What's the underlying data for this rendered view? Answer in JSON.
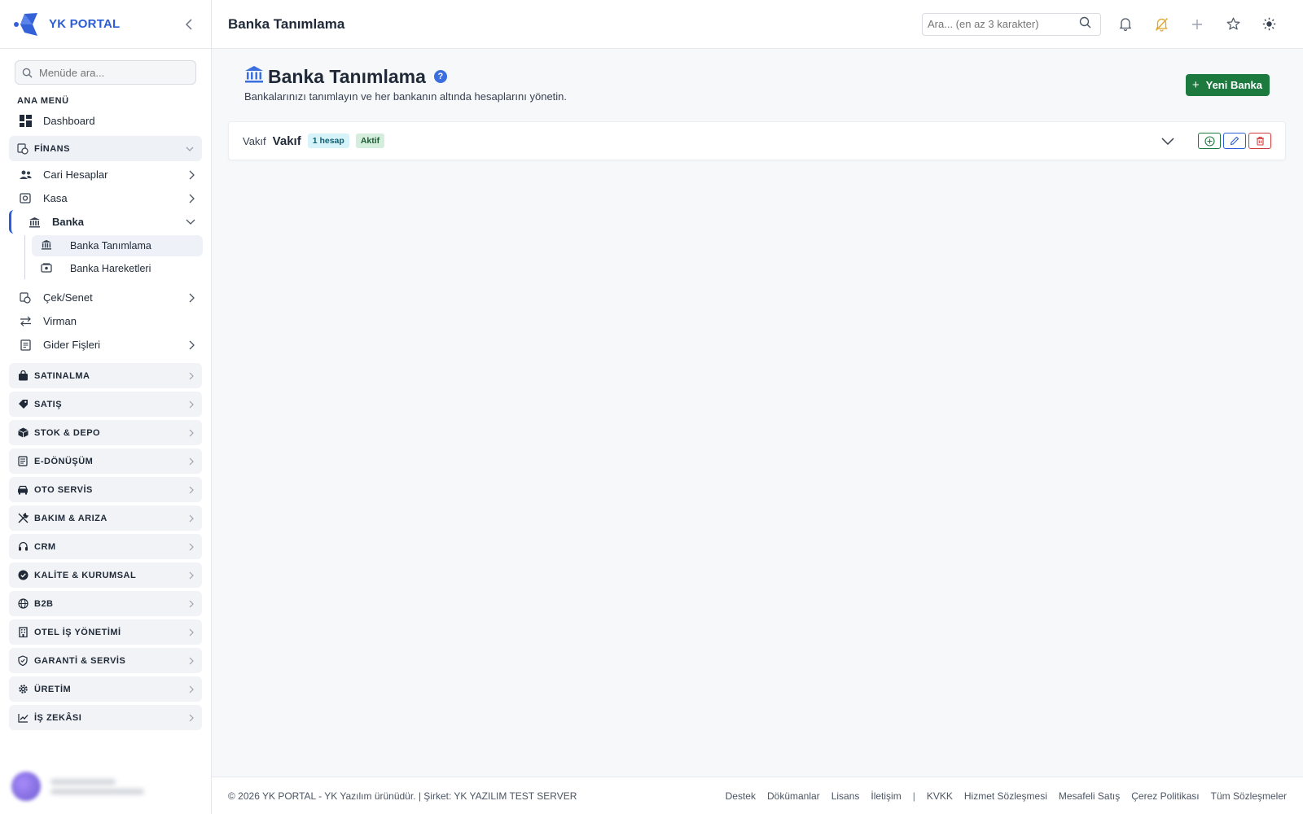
{
  "brand": {
    "name": "YK PORTAL"
  },
  "sidebar": {
    "search_placeholder": "Menüde ara...",
    "section_label": "ANA MENÜ",
    "dashboard": "Dashboard",
    "finance_group": "FİNANS",
    "finance_items": {
      "cari": "Cari Hesaplar",
      "kasa": "Kasa",
      "banka": "Banka",
      "banka_tanimlama": "Banka Tanımlama",
      "banka_hareketleri": "Banka Hareketleri",
      "cek_senet": "Çek/Senet",
      "virman": "Virman",
      "gider": "Gider Fişleri"
    },
    "groups": [
      "SATINALMA",
      "SATIŞ",
      "STOK & DEPO",
      "E-DÖNÜŞÜM",
      "OTO SERVİS",
      "BAKIM & ARIZA",
      "CRM",
      "KALİTE & KURUMSAL",
      "B2B",
      "OTEL İŞ YÖNETİMİ",
      "GARANTİ & SERVİS",
      "ÜRETİM",
      "İŞ ZEKÂSI"
    ]
  },
  "topbar": {
    "title": "Banka Tanımlama",
    "search_placeholder": "Ara... (en az 3 karakter)"
  },
  "page": {
    "title": "Banka Tanımlama",
    "help": "?",
    "subtitle": "Bankalarınızı tanımlayın ve her bankanın altında hesaplarını yönetin.",
    "new_button": "Yeni Banka"
  },
  "banks": [
    {
      "short_name": "Vakıf",
      "name": "Vakıf",
      "account_count": "1 hesap",
      "status": "Aktif"
    }
  ],
  "footer": {
    "copyright": "© 2026 YK PORTAL - YK Yazılım ürünüdür. | Şirket: YK YAZILIM TEST SERVER",
    "links_left": [
      "Destek",
      "Dökümanlar",
      "Lisans",
      "İletişim"
    ],
    "separator": "|",
    "links_right": [
      "KVKK",
      "Hizmet Sözleşmesi",
      "Mesafeli Satış",
      "Çerez Politikası",
      "Tüm Sözleşmeler"
    ]
  },
  "colors": {
    "accent": "#2b5cd9",
    "primary_button": "#1c7a3f",
    "badge_count_bg": "#d6f3fa",
    "badge_status_bg": "#d4eddc",
    "delete": "#d23b3b"
  }
}
